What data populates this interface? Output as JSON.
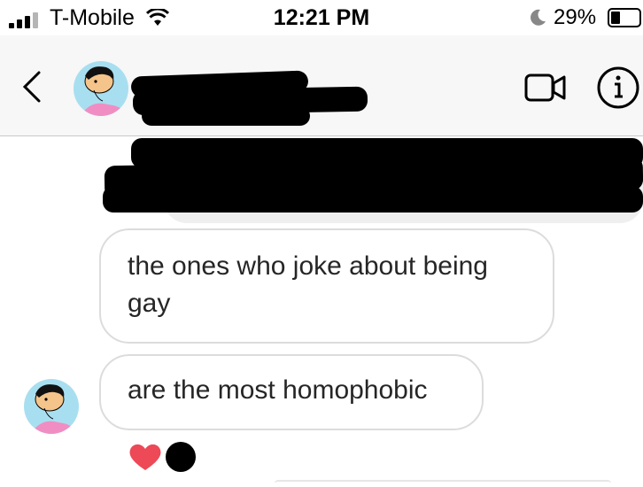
{
  "status_bar": {
    "carrier": "T-Mobile",
    "time": "12:21 PM",
    "battery": "29%"
  },
  "header": {
    "contact_name": "",
    "icons": [
      "back-chevron-icon",
      "video-call-icon",
      "info-icon"
    ]
  },
  "messages": [
    {
      "sender": "contact",
      "text": "the ones who joke about being gay"
    },
    {
      "sender": "contact",
      "text": "are the most homophobic"
    }
  ],
  "reactions": [
    "heart",
    "black-circle"
  ],
  "colors": {
    "header_bg": "#f7f7f7",
    "bubble_border": "#dcdcdc",
    "heart": "#ed4956",
    "quoted_bg": "#efefef"
  }
}
